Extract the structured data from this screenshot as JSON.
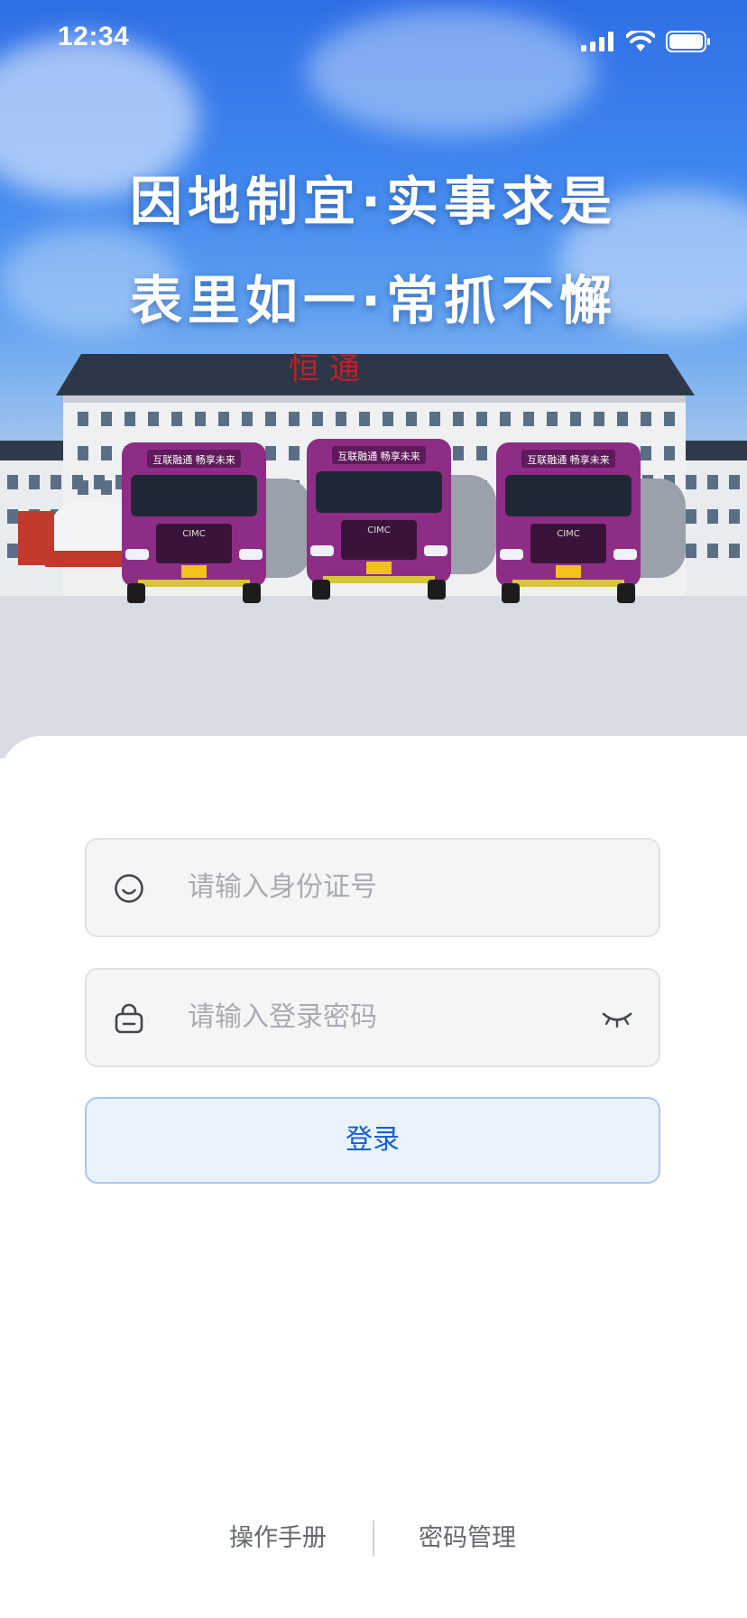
{
  "status_bar": {
    "time": "12:34"
  },
  "hero": {
    "slogan_line1": "因地制宜·实事求是",
    "slogan_line2": "表里如一·常抓不懈",
    "building_sign": "恒 通",
    "truck_banner": "互联融通 畅享未来",
    "truck_brand": "CIMC"
  },
  "login": {
    "id_placeholder": "请输入身份证号",
    "password_placeholder": "请输入登录密码",
    "login_label": "登录"
  },
  "footer": {
    "manual_label": "操作手册",
    "password_mgmt_label": "密码管理"
  },
  "icons": {
    "user": "smiley-icon",
    "password": "lock-icon",
    "visibility": "eye-closed-icon"
  },
  "colors": {
    "accent": "#1560d4",
    "button_bg": "#eaf2fe",
    "button_border": "#a9c8f3",
    "truck": "#8e2d86"
  }
}
